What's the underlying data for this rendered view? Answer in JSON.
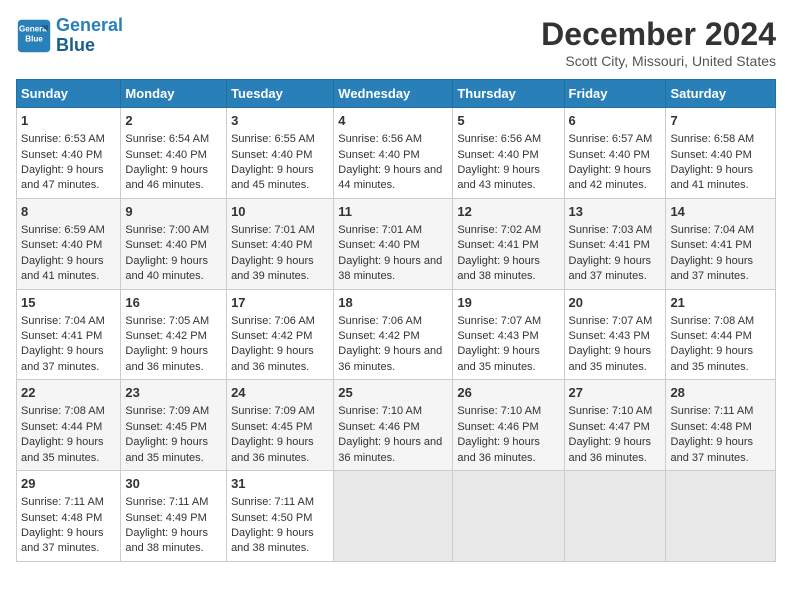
{
  "header": {
    "logo_line1": "General",
    "logo_line2": "Blue",
    "title": "December 2024",
    "subtitle": "Scott City, Missouri, United States"
  },
  "days_of_week": [
    "Sunday",
    "Monday",
    "Tuesday",
    "Wednesday",
    "Thursday",
    "Friday",
    "Saturday"
  ],
  "weeks": [
    [
      {
        "day": "1",
        "content": "Sunrise: 6:53 AM\nSunset: 4:40 PM\nDaylight: 9 hours and 47 minutes."
      },
      {
        "day": "2",
        "content": "Sunrise: 6:54 AM\nSunset: 4:40 PM\nDaylight: 9 hours and 46 minutes."
      },
      {
        "day": "3",
        "content": "Sunrise: 6:55 AM\nSunset: 4:40 PM\nDaylight: 9 hours and 45 minutes."
      },
      {
        "day": "4",
        "content": "Sunrise: 6:56 AM\nSunset: 4:40 PM\nDaylight: 9 hours and 44 minutes."
      },
      {
        "day": "5",
        "content": "Sunrise: 6:56 AM\nSunset: 4:40 PM\nDaylight: 9 hours and 43 minutes."
      },
      {
        "day": "6",
        "content": "Sunrise: 6:57 AM\nSunset: 4:40 PM\nDaylight: 9 hours and 42 minutes."
      },
      {
        "day": "7",
        "content": "Sunrise: 6:58 AM\nSunset: 4:40 PM\nDaylight: 9 hours and 41 minutes."
      }
    ],
    [
      {
        "day": "8",
        "content": "Sunrise: 6:59 AM\nSunset: 4:40 PM\nDaylight: 9 hours and 41 minutes."
      },
      {
        "day": "9",
        "content": "Sunrise: 7:00 AM\nSunset: 4:40 PM\nDaylight: 9 hours and 40 minutes."
      },
      {
        "day": "10",
        "content": "Sunrise: 7:01 AM\nSunset: 4:40 PM\nDaylight: 9 hours and 39 minutes."
      },
      {
        "day": "11",
        "content": "Sunrise: 7:01 AM\nSunset: 4:40 PM\nDaylight: 9 hours and 38 minutes."
      },
      {
        "day": "12",
        "content": "Sunrise: 7:02 AM\nSunset: 4:41 PM\nDaylight: 9 hours and 38 minutes."
      },
      {
        "day": "13",
        "content": "Sunrise: 7:03 AM\nSunset: 4:41 PM\nDaylight: 9 hours and 37 minutes."
      },
      {
        "day": "14",
        "content": "Sunrise: 7:04 AM\nSunset: 4:41 PM\nDaylight: 9 hours and 37 minutes."
      }
    ],
    [
      {
        "day": "15",
        "content": "Sunrise: 7:04 AM\nSunset: 4:41 PM\nDaylight: 9 hours and 37 minutes."
      },
      {
        "day": "16",
        "content": "Sunrise: 7:05 AM\nSunset: 4:42 PM\nDaylight: 9 hours and 36 minutes."
      },
      {
        "day": "17",
        "content": "Sunrise: 7:06 AM\nSunset: 4:42 PM\nDaylight: 9 hours and 36 minutes."
      },
      {
        "day": "18",
        "content": "Sunrise: 7:06 AM\nSunset: 4:42 PM\nDaylight: 9 hours and 36 minutes."
      },
      {
        "day": "19",
        "content": "Sunrise: 7:07 AM\nSunset: 4:43 PM\nDaylight: 9 hours and 35 minutes."
      },
      {
        "day": "20",
        "content": "Sunrise: 7:07 AM\nSunset: 4:43 PM\nDaylight: 9 hours and 35 minutes."
      },
      {
        "day": "21",
        "content": "Sunrise: 7:08 AM\nSunset: 4:44 PM\nDaylight: 9 hours and 35 minutes."
      }
    ],
    [
      {
        "day": "22",
        "content": "Sunrise: 7:08 AM\nSunset: 4:44 PM\nDaylight: 9 hours and 35 minutes."
      },
      {
        "day": "23",
        "content": "Sunrise: 7:09 AM\nSunset: 4:45 PM\nDaylight: 9 hours and 35 minutes."
      },
      {
        "day": "24",
        "content": "Sunrise: 7:09 AM\nSunset: 4:45 PM\nDaylight: 9 hours and 36 minutes."
      },
      {
        "day": "25",
        "content": "Sunrise: 7:10 AM\nSunset: 4:46 PM\nDaylight: 9 hours and 36 minutes."
      },
      {
        "day": "26",
        "content": "Sunrise: 7:10 AM\nSunset: 4:46 PM\nDaylight: 9 hours and 36 minutes."
      },
      {
        "day": "27",
        "content": "Sunrise: 7:10 AM\nSunset: 4:47 PM\nDaylight: 9 hours and 36 minutes."
      },
      {
        "day": "28",
        "content": "Sunrise: 7:11 AM\nSunset: 4:48 PM\nDaylight: 9 hours and 37 minutes."
      }
    ],
    [
      {
        "day": "29",
        "content": "Sunrise: 7:11 AM\nSunset: 4:48 PM\nDaylight: 9 hours and 37 minutes."
      },
      {
        "day": "30",
        "content": "Sunrise: 7:11 AM\nSunset: 4:49 PM\nDaylight: 9 hours and 38 minutes."
      },
      {
        "day": "31",
        "content": "Sunrise: 7:11 AM\nSunset: 4:50 PM\nDaylight: 9 hours and 38 minutes."
      },
      {
        "day": "",
        "content": ""
      },
      {
        "day": "",
        "content": ""
      },
      {
        "day": "",
        "content": ""
      },
      {
        "day": "",
        "content": ""
      }
    ]
  ]
}
